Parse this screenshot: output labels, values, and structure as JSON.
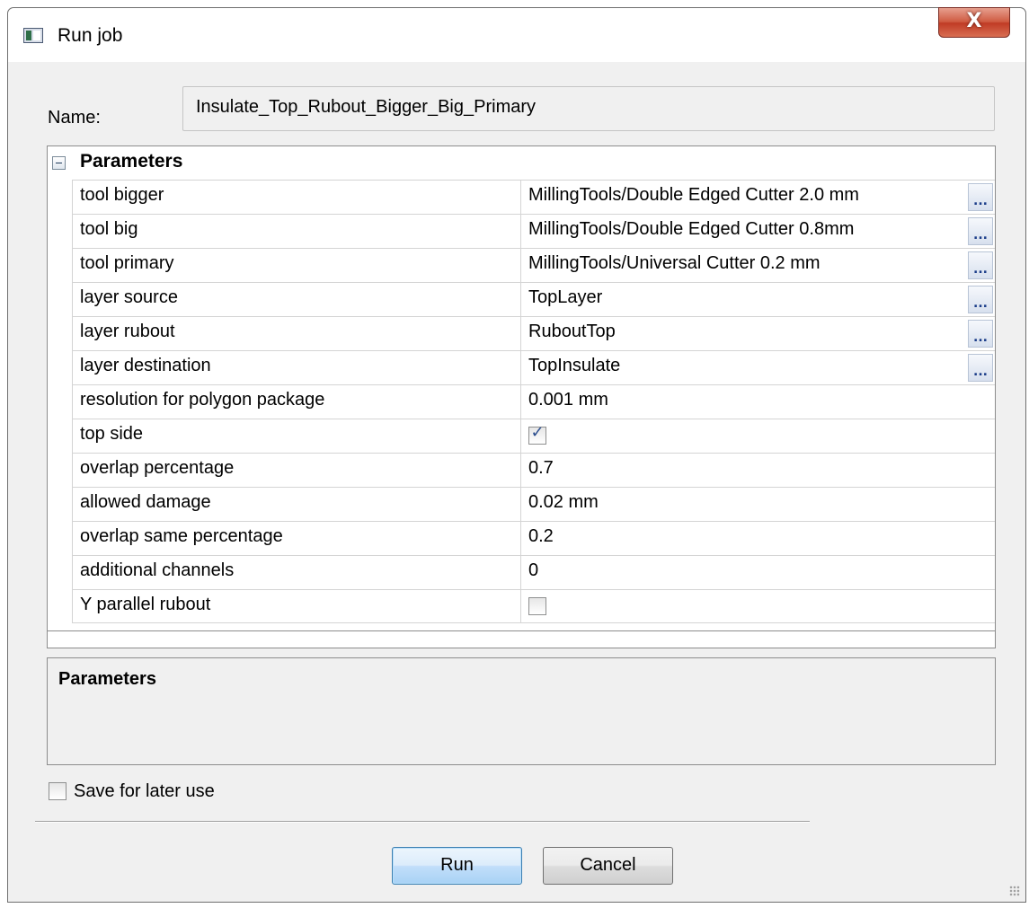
{
  "window": {
    "title": "Run job",
    "close_label": "X"
  },
  "name": {
    "label": "Name:",
    "value": "Insulate_Top_Rubout_Bigger_Big_Primary"
  },
  "parameters": {
    "group_title": "Parameters",
    "browse_label": "...",
    "rows": [
      {
        "name": "tool bigger",
        "value": "MillingTools/Double Edged Cutter 2.0 mm",
        "browse": true
      },
      {
        "name": "tool big",
        "value": "MillingTools/Double Edged Cutter 0.8mm",
        "browse": true
      },
      {
        "name": "tool primary",
        "value": "MillingTools/Universal Cutter 0.2 mm",
        "browse": true
      },
      {
        "name": "layer source",
        "value": "TopLayer",
        "browse": true
      },
      {
        "name": "layer rubout",
        "value": "RuboutTop",
        "browse": true
      },
      {
        "name": "layer destination",
        "value": "TopInsulate",
        "browse": true
      },
      {
        "name": "resolution for polygon package",
        "value": "0.001 mm"
      },
      {
        "name": "top side",
        "checked": true
      },
      {
        "name": "overlap percentage",
        "value": "0.7"
      },
      {
        "name": "allowed damage",
        "value": "0.02 mm"
      },
      {
        "name": "overlap same percentage",
        "value": "0.2"
      },
      {
        "name": "additional channels",
        "value": "0"
      },
      {
        "name": "Y parallel rubout",
        "checked": false
      }
    ]
  },
  "description": {
    "title": "Parameters"
  },
  "save": {
    "label": "Save for later use",
    "checked": false
  },
  "buttons": {
    "run": "Run",
    "cancel": "Cancel"
  }
}
